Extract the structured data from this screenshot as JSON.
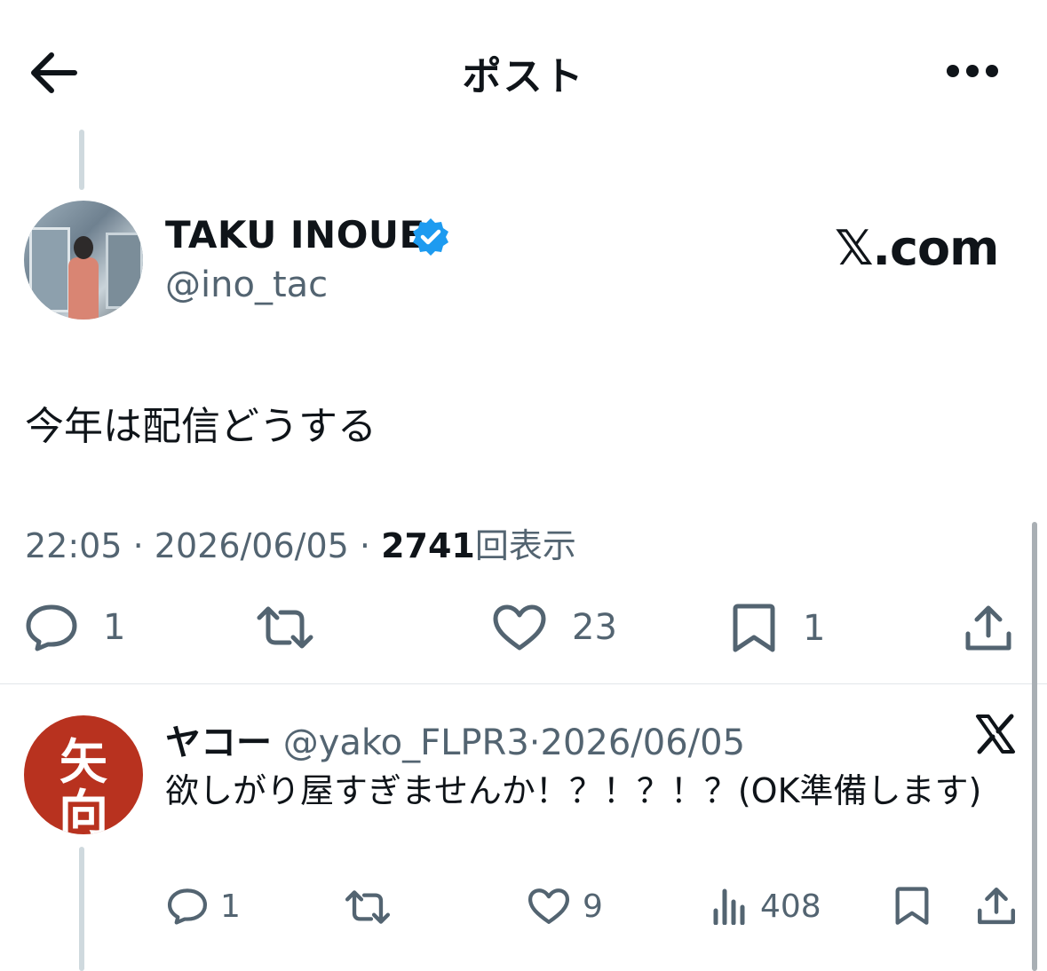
{
  "header": {
    "title": "ポスト",
    "back_icon": "arrow-left-icon",
    "more_icon": "more-horizontal-icon"
  },
  "post": {
    "author_name": "TAKU INOUE",
    "author_handle": "@ino_tac",
    "verified": true,
    "watermark": "𝕏.com",
    "text": "今年は配信どうする",
    "time": "22:05",
    "sep1": "·",
    "date": "2026/06/05",
    "sep2": "·",
    "views_count": "2741",
    "views_label": "回表示",
    "actions": {
      "reply_count": "1",
      "repost_count": "",
      "like_count": "23",
      "bookmark_count": "1"
    }
  },
  "reply": {
    "author_name": "ヤコー",
    "author_handle": "@yako_FLPR3",
    "sep": "·",
    "date": "2026/06/05",
    "avatar_text_top": "矢",
    "avatar_text_bottom": "向",
    "text": "欲しがり屋すぎませんか！？！？！？(OK準備します)",
    "actions": {
      "reply_count": "1",
      "like_count": "9",
      "views_count": "408"
    }
  },
  "colors": {
    "text_primary": "#0f1419",
    "text_secondary": "#536471",
    "verified_blue": "#1d9bf0",
    "avatar2_red": "#b8321f"
  }
}
